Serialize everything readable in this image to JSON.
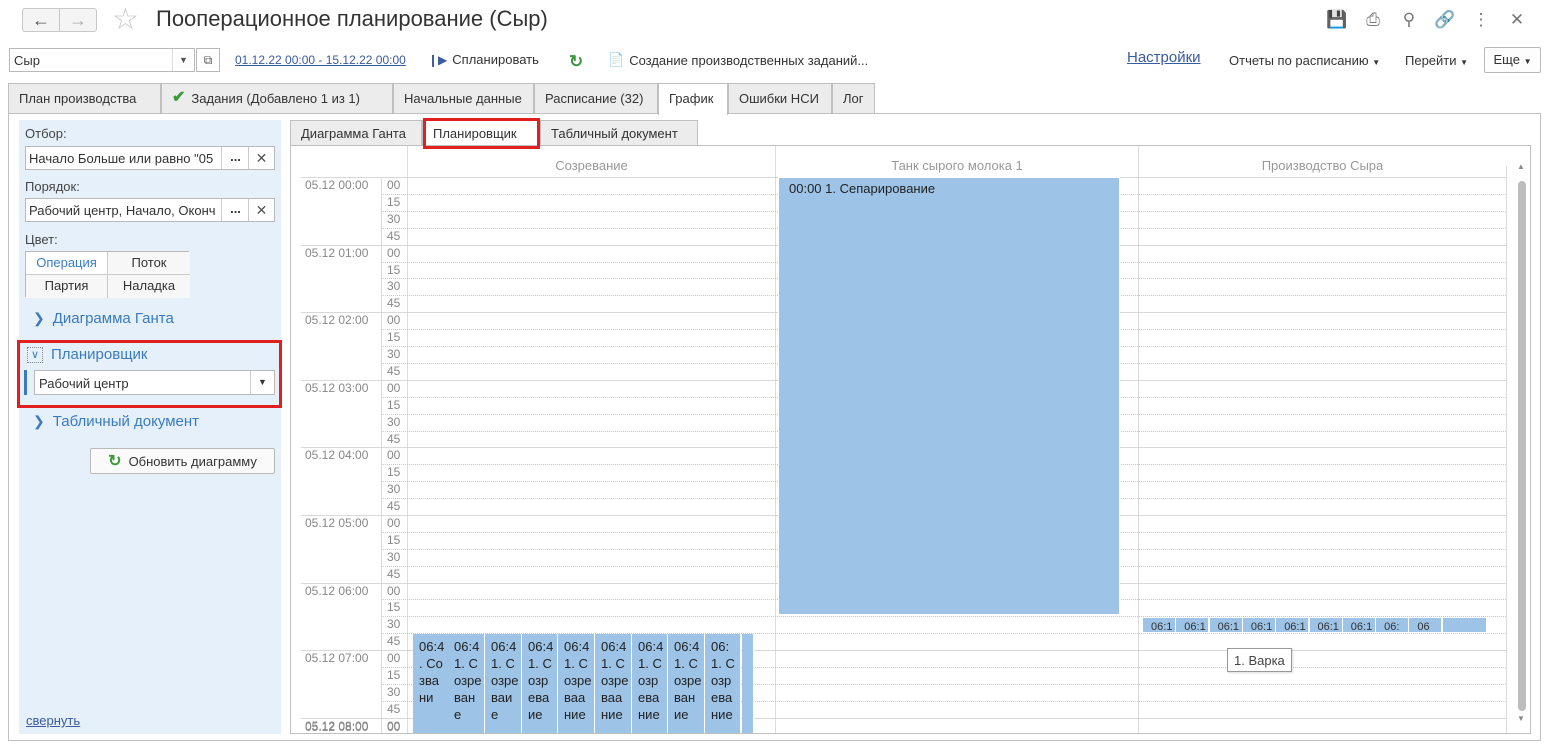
{
  "window": {
    "title": "Пооперационное планирование (Сыр)"
  },
  "toolbar": {
    "object_value": "Сыр",
    "period": "01.12.22 00:00 - 15.12.22 00:00",
    "plan_label": "Спланировать",
    "create_tasks_label": "Создание производственных заданий...",
    "settings_label": "Настройки",
    "reports_label": "Отчеты по расписанию",
    "goto_label": "Перейти",
    "more_label": "Еще"
  },
  "main_tabs": [
    {
      "label": "План производства"
    },
    {
      "label": "Задания (Добавлено 1 из 1)"
    },
    {
      "label": "Начальные данные"
    },
    {
      "label": "Расписание (32)"
    },
    {
      "label": "График"
    },
    {
      "label": "Ошибки НСИ"
    },
    {
      "label": "Лог"
    }
  ],
  "left_panel": {
    "filter_label": "Отбор:",
    "filter_value": "Начало Больше или равно \"05",
    "order_label": "Порядок:",
    "order_value": "Рабочий центр, Начало, Оконч",
    "color_label": "Цвет:",
    "color_buttons": [
      "Операция",
      "Поток",
      "Партия",
      "Наладка"
    ],
    "section_gantt": "Диаграмма Ганта",
    "section_planner": "Планировщик",
    "planner_select": "Рабочий центр",
    "section_table": "Табличный документ",
    "refresh_label": "Обновить диаграмму",
    "collapse_label": "свернуть"
  },
  "inner_tabs": [
    {
      "label": "Диаграмма Ганта"
    },
    {
      "label": "Планировщик"
    },
    {
      "label": "Табличный документ"
    }
  ],
  "planner": {
    "columns": [
      "Созревание",
      "Танк сырого молока  1",
      "Производство Сыра"
    ],
    "hours": [
      "05.12 00:00",
      "05.12 01:00",
      "05.12 02:00",
      "05.12 03:00",
      "05.12 04:00",
      "05.12 05:00",
      "05.12 06:00",
      "05.12 07:00",
      "05.12 08:00"
    ],
    "minutes": [
      "00",
      "15",
      "30",
      "45"
    ],
    "tank_block": "00:00 1. Сепарирование",
    "maturing_blocks": [
      "06:4 . Созвани",
      "06:4 1. Созреване",
      "06:4 1. Созреваие",
      "06:4 1. Созреваие",
      "06:4 1. Созреваание",
      "06:4 1. Созреваание",
      "06:4 1. Созревание",
      "06:4 1. Созревание",
      "06: 1. Созревание"
    ],
    "cheese_blocks": [
      "06:1",
      "06:1",
      "06:1",
      "06:1",
      "06:1",
      "06:1",
      "06:1",
      "06:",
      "06"
    ],
    "tooltip": "1. Варка"
  },
  "colors": {
    "block": "#9dc3e6",
    "highlight": "#e02020",
    "link": "#3a5b9c",
    "panel_bg": "#e6f0fa"
  }
}
